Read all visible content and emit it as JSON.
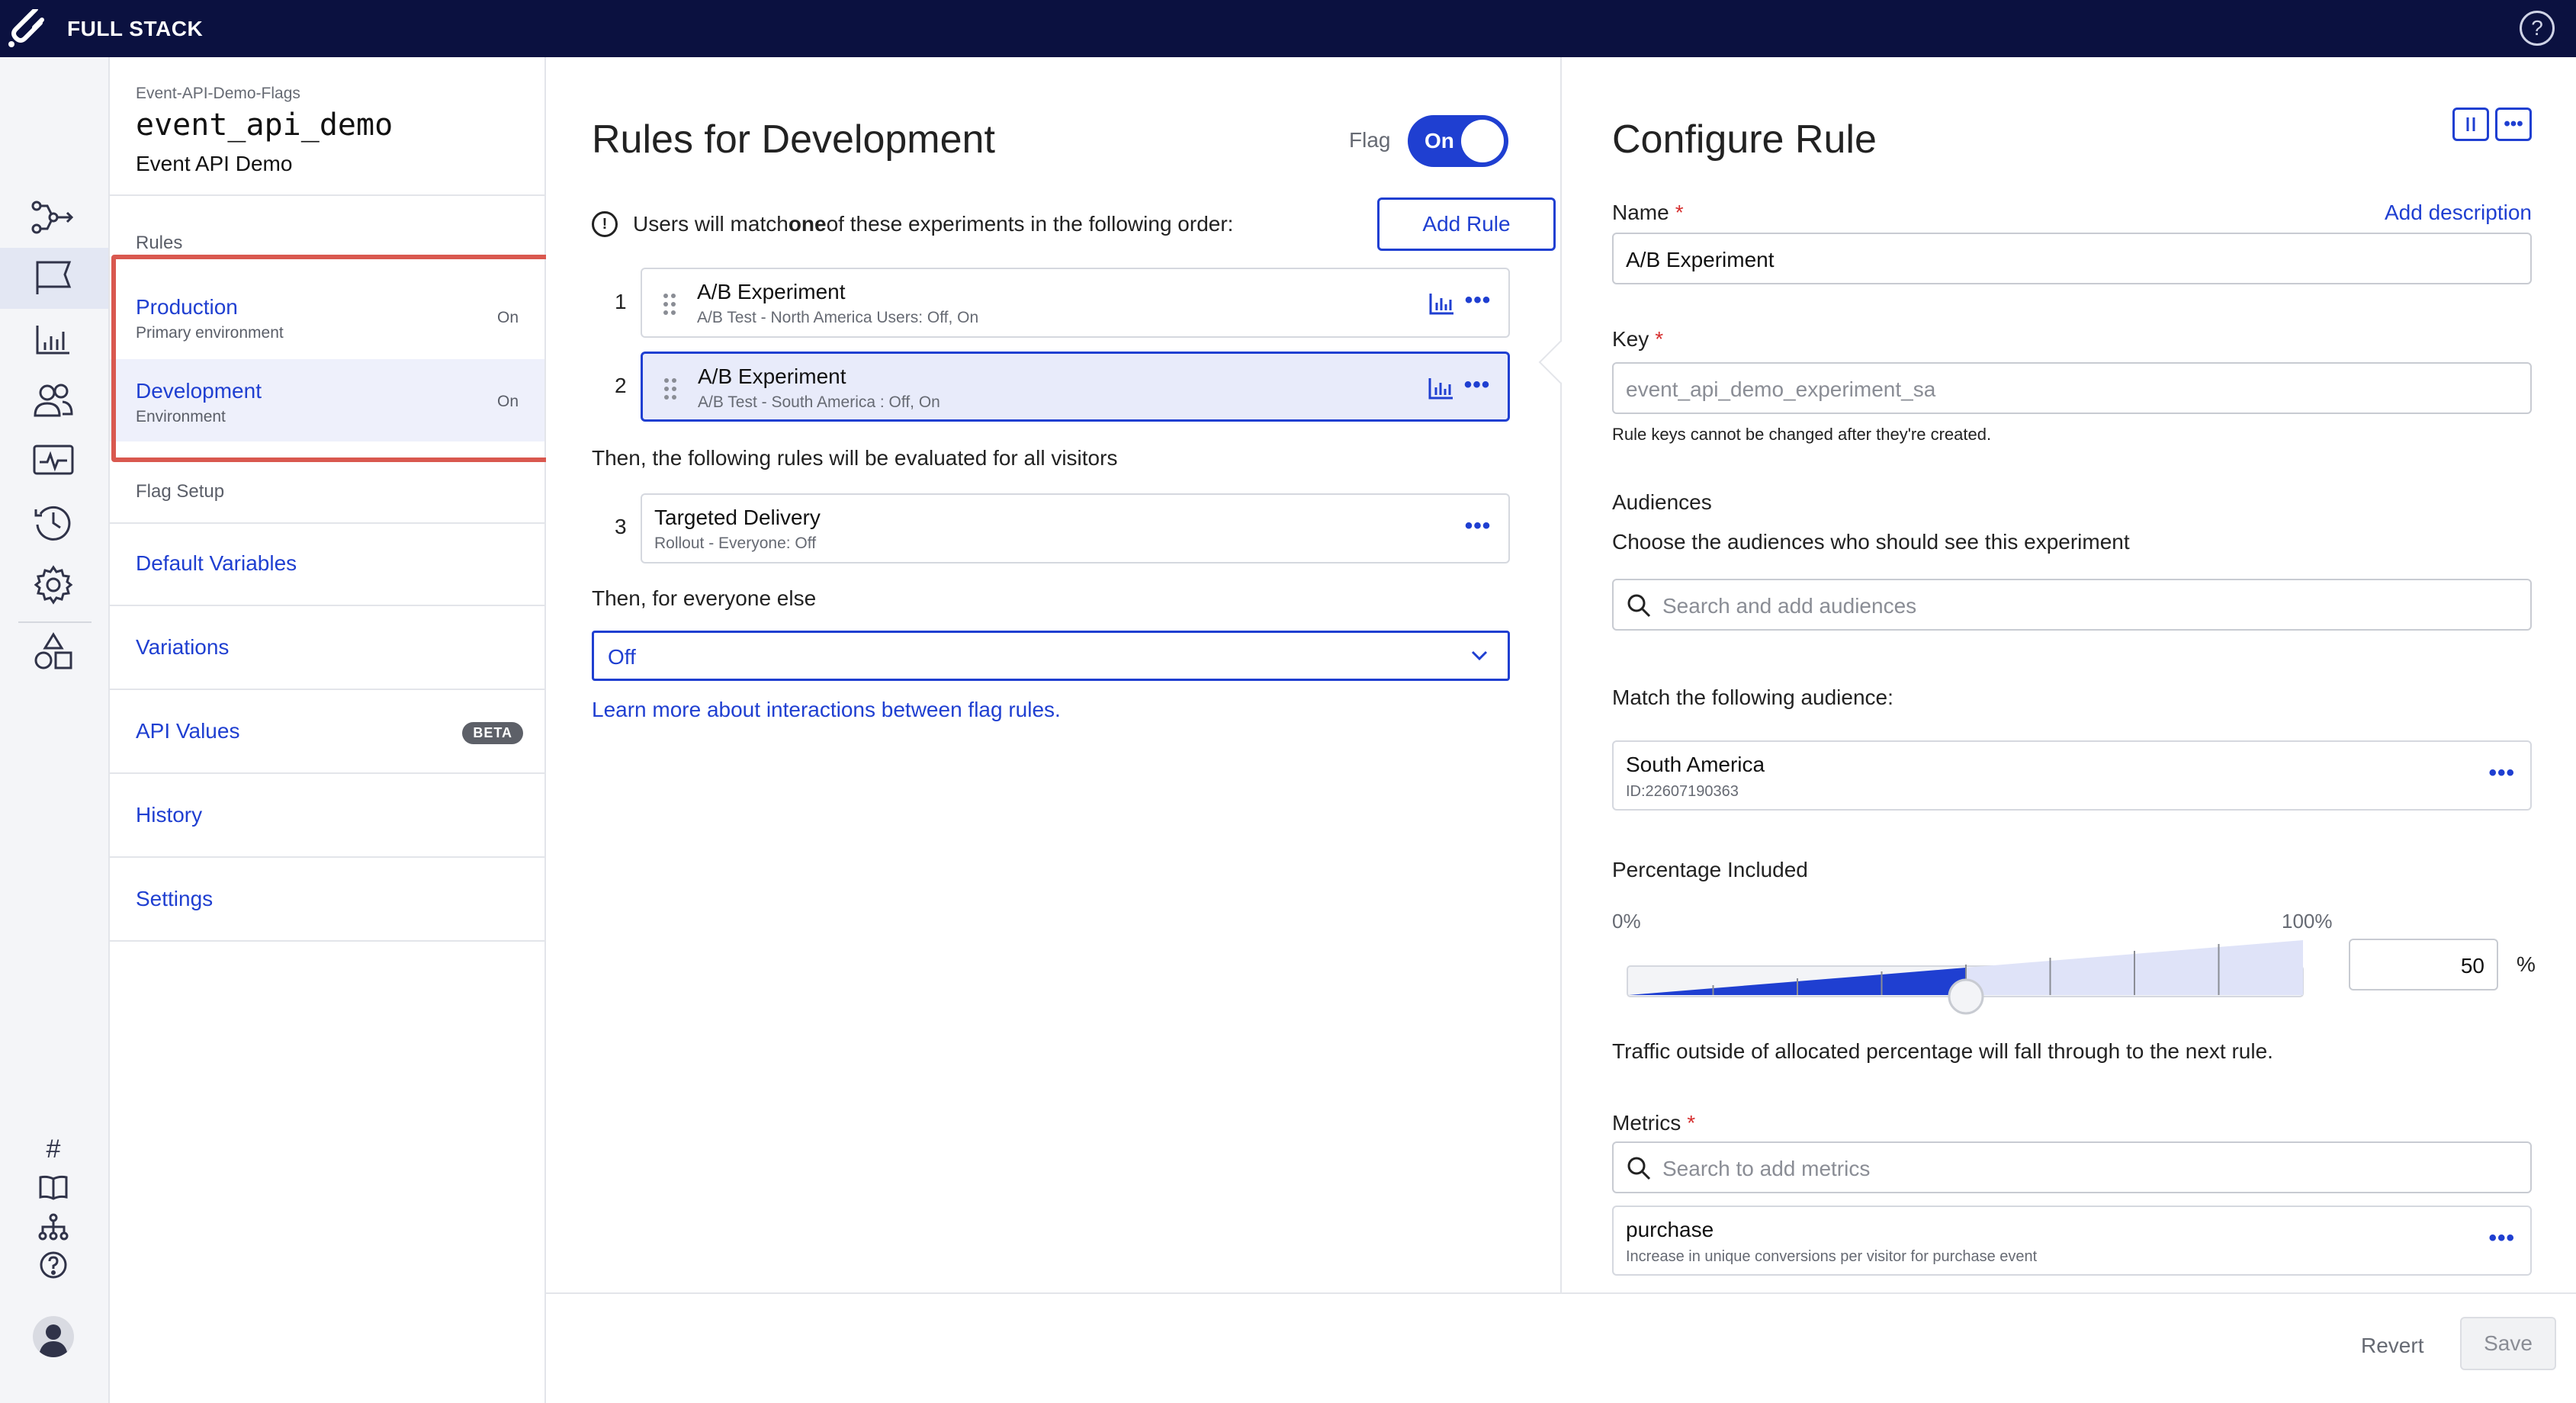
{
  "topbar": {
    "brand": "FULL STACK",
    "help_icon": "?"
  },
  "rail": {
    "icons": [
      "flows-icon",
      "flag-icon",
      "chart-icon",
      "users-icon",
      "monitor-icon",
      "history-icon",
      "gear-icon",
      "shapes-icon"
    ],
    "bottom": {
      "hash": "#",
      "help": "?"
    }
  },
  "flag": {
    "breadcrumb": "Event-API-Demo-Flags",
    "key": "event_api_demo",
    "name": "Event API Demo"
  },
  "sidebar": {
    "rules_label": "Rules",
    "environments": [
      {
        "name": "Production",
        "sub": "Primary environment",
        "status": "On"
      },
      {
        "name": "Development",
        "sub": "Environment",
        "status": "On"
      }
    ],
    "flag_setup_label": "Flag Setup",
    "nav": [
      {
        "label": "Default Variables"
      },
      {
        "label": "Variations"
      },
      {
        "label": "API Values",
        "badge": "BETA"
      },
      {
        "label": "History"
      },
      {
        "label": "Settings"
      }
    ]
  },
  "rules": {
    "title": "Rules for Development",
    "flag_label": "Flag",
    "toggle_label": "On",
    "notice_pre": "Users will match ",
    "notice_bold": "one",
    "notice_post": " of these experiments in the following order:",
    "add_rule": "Add Rule",
    "items": [
      {
        "num": "1",
        "title": "A/B Experiment",
        "sub": "A/B Test - North America Users: Off, On"
      },
      {
        "num": "2",
        "title": "A/B Experiment",
        "sub": "A/B Test - South America : Off, On"
      }
    ],
    "then_all": "Then, the following rules will be evaluated for all visitors",
    "delivery": {
      "num": "3",
      "title": "Targeted Delivery",
      "sub": "Rollout - Everyone: Off"
    },
    "then_else": "Then, for everyone else",
    "else_value": "Off",
    "learn_more": "Learn more about interactions between flag rules.",
    "more": "•••"
  },
  "configure": {
    "title": "Configure Rule",
    "name_label": "Name",
    "add_description": "Add description",
    "name_value": "A/B Experiment",
    "key_label": "Key",
    "key_placeholder": "event_api_demo_experiment_sa",
    "key_hint": "Rule keys cannot be changed after they're created.",
    "audiences_label": "Audiences",
    "audiences_help": "Choose the audiences who should see this experiment",
    "audiences_placeholder": "Search and add audiences",
    "match_label": "Match the following audience:",
    "audience": {
      "name": "South America",
      "id": "ID:22607190363"
    },
    "percentage_label": "Percentage Included",
    "pct_min": "0%",
    "pct_max": "100%",
    "percentage_value": "50",
    "pct_symbol": "%",
    "traffic_note": "Traffic outside of allocated percentage will fall through to the next rule.",
    "metrics_label": "Metrics",
    "metrics_placeholder": "Search to add metrics",
    "metric": {
      "name": "purchase",
      "desc": "Increase in unique conversions per visitor for purchase event"
    },
    "more": "•••"
  },
  "footer": {
    "revert": "Revert",
    "save": "Save"
  },
  "colors": {
    "brand_blue": "#1f3fd1",
    "topbar": "#0b1140",
    "highlight": "#d9584f"
  },
  "slider_fraction": 0.5
}
